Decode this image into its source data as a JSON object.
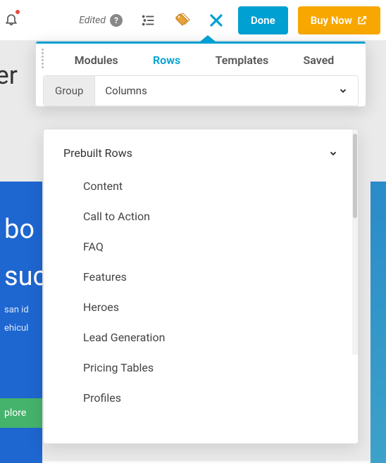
{
  "toolbar": {
    "edited_label": "Edited",
    "done_label": "Done",
    "buy_label": "Buy Now"
  },
  "panel": {
    "tabs": {
      "modules": "Modules",
      "rows": "Rows",
      "templates": "Templates",
      "saved": "Saved"
    },
    "subbar": {
      "group_label": "Group",
      "select_value": "Columns"
    },
    "prebuilt": {
      "header": "Prebuilt Rows",
      "items": [
        "Content",
        "Call to Action",
        "FAQ",
        "Features",
        "Heroes",
        "Lead Generation",
        "Pricing Tables",
        "Profiles"
      ]
    }
  },
  "background": {
    "title_fragment": "Der",
    "hero_big_1": "bo",
    "hero_big_2": "suc",
    "hero_small_1": "san id",
    "hero_small_2": "ehicul",
    "explore_fragment": "plore"
  }
}
